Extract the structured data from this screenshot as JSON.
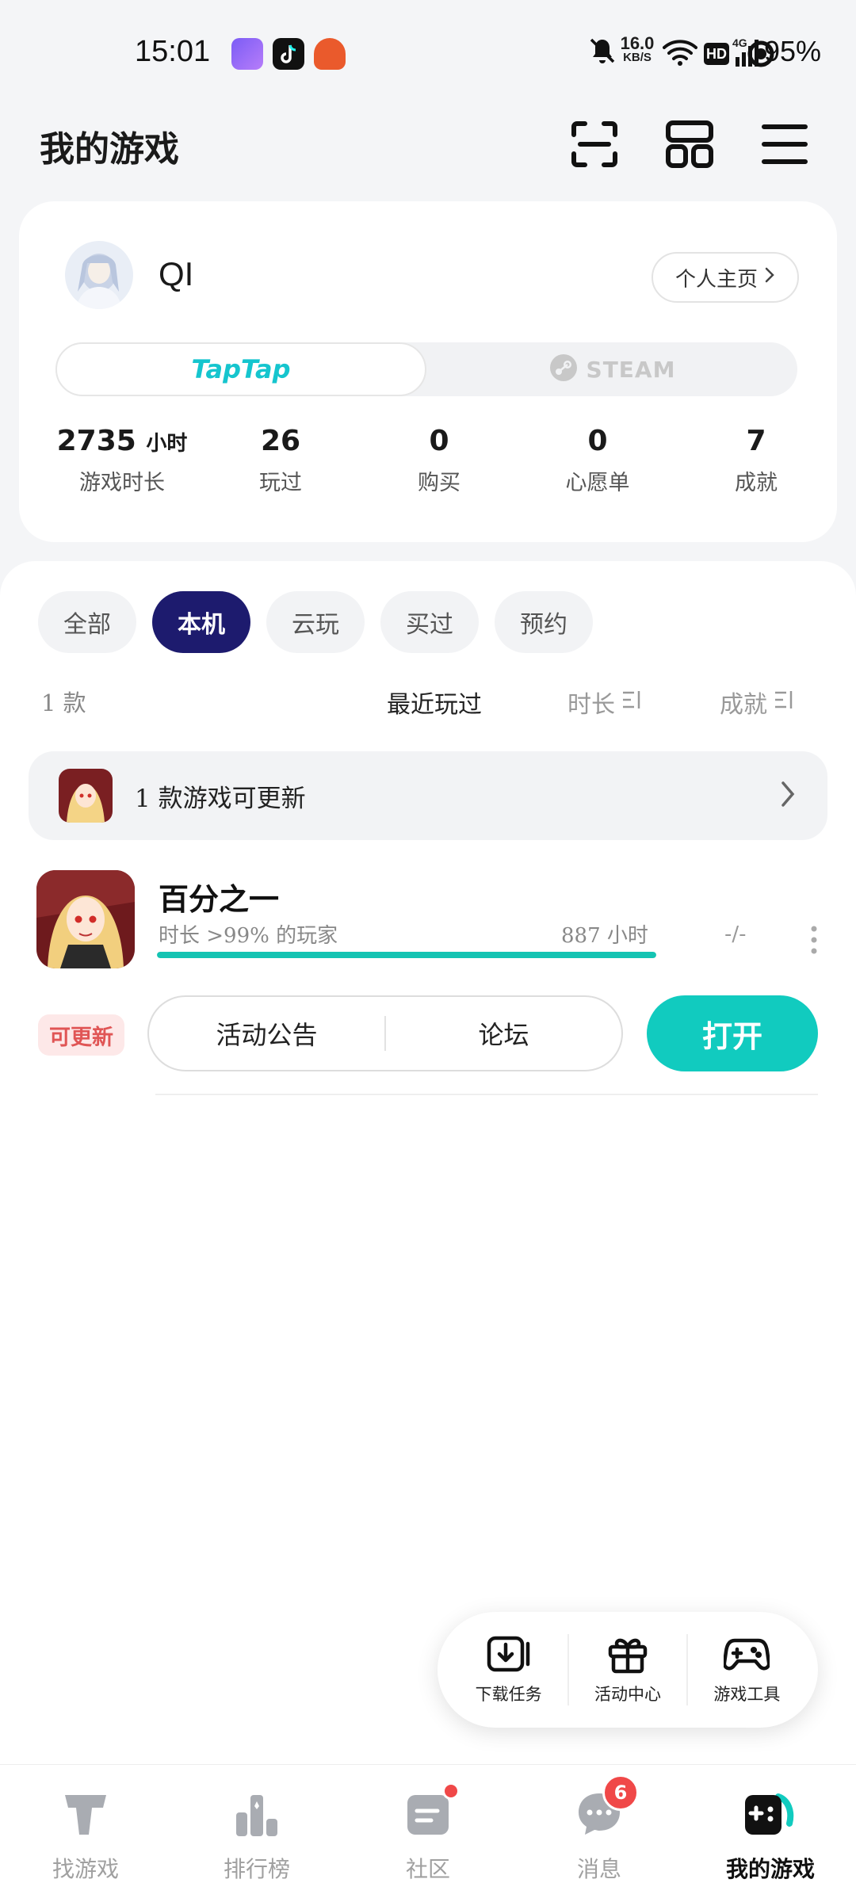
{
  "status_bar": {
    "time": "15:01",
    "net_speed_value": "16.0",
    "net_speed_unit": "KB/S",
    "hd_label": "HD",
    "network_label": "4G",
    "battery": "95%"
  },
  "header": {
    "title": "我的游戏",
    "icons": [
      "scan-icon",
      "layout-grid-icon",
      "menu-icon"
    ]
  },
  "profile": {
    "username": "QI",
    "home_button": "个人主页",
    "platform_tabs": [
      "TapTap",
      "STEAM"
    ],
    "stats": [
      {
        "value": "2735",
        "unit": "小时",
        "label": "游戏时长"
      },
      {
        "value": "26",
        "unit": "",
        "label": "玩过"
      },
      {
        "value": "0",
        "unit": "",
        "label": "购买"
      },
      {
        "value": "0",
        "unit": "",
        "label": "心愿单"
      },
      {
        "value": "7",
        "unit": "",
        "label": "成就"
      }
    ]
  },
  "filters": {
    "chips": [
      "全部",
      "本机",
      "云玩",
      "买过",
      "预约"
    ],
    "active_index": 1
  },
  "list_header": {
    "count": "1 款",
    "sort_recent": "最近玩过",
    "sort_duration": "时长",
    "sort_achievement": "成就"
  },
  "update_banner": {
    "text": "1 款游戏可更新"
  },
  "game": {
    "name": "百分之一",
    "subtitle": "时长 >99% 的玩家",
    "hours": "887 小时",
    "achievements": "-/-",
    "progress": 1.0,
    "badge": "可更新",
    "btn_announcement": "活动公告",
    "btn_forum": "论坛",
    "btn_open": "打开"
  },
  "tools": {
    "items": [
      "下载任务",
      "活动中心",
      "游戏工具"
    ]
  },
  "nav": {
    "items": [
      "找游戏",
      "排行榜",
      "社区",
      "消息",
      "我的游戏"
    ],
    "message_badge": "6",
    "active_index": 4
  },
  "colors": {
    "accent_teal": "#11cbbf",
    "active_chip": "#1d1b6e",
    "badge_red": "#f04848",
    "taptap_blue": "#15c5ce"
  }
}
